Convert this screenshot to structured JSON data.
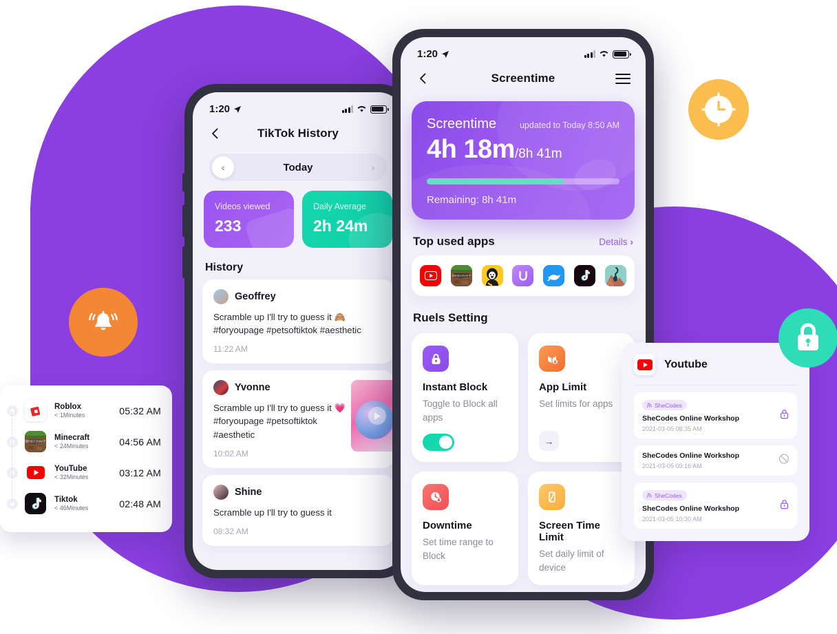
{
  "background": {
    "purple": "#8A3FE0",
    "accent_teal": "#14D9AE",
    "accent_orange": "#F58634",
    "accent_yellow": "#FBBD4E"
  },
  "fabs": [
    {
      "name": "notification-bell-badge",
      "icon": "bell-icon",
      "color": "#F58634"
    },
    {
      "name": "clock-badge",
      "icon": "clock-icon",
      "color": "#FBBD4E"
    },
    {
      "name": "lock-badge",
      "icon": "lock-icon",
      "color": "#2FDCB8"
    }
  ],
  "screentime_phone": {
    "statusbar": {
      "time": "1:20",
      "location_icon": "location-arrow-icon",
      "signal_icon": "cellular-signal-icon",
      "wifi_icon": "wifi-icon",
      "battery_icon": "battery-icon"
    },
    "navbar": {
      "back_icon": "chevron-left-icon",
      "title": "Screentime",
      "menu_icon": "hamburger-menu-icon"
    },
    "card": {
      "label": "Screentime",
      "updated": "updated to Today 8:50 AM",
      "used": "4h 18m",
      "total": "/8h 41m",
      "progress_percent": 71,
      "remaining": "Remaining: 8h 41m"
    },
    "top_apps": {
      "title": "Top used apps",
      "details_label": "Details",
      "details_chevron": "›",
      "apps": [
        {
          "name": "youtube",
          "label": "YouTube"
        },
        {
          "name": "minecraft",
          "label": "Minecraft"
        },
        {
          "name": "gorilla-game",
          "label": "Gorilla Tag"
        },
        {
          "name": "u-app",
          "label": "U"
        },
        {
          "name": "bird-app",
          "label": "Bird"
        },
        {
          "name": "tiktok",
          "label": "TikTok"
        },
        {
          "name": "adventure-game",
          "label": "Adventure"
        }
      ]
    },
    "rules": {
      "title": "Ruels Setting",
      "items": [
        {
          "name": "instant-block",
          "icon": "lock-icon",
          "icon_color": "#8B4BE8",
          "title": "Instant Block",
          "desc": "Toggle to Block all apps",
          "control": "toggle",
          "toggle_on": true
        },
        {
          "name": "app-limit",
          "icon": "app-limit-icon",
          "icon_color": "#F5803E",
          "title": "App Limit",
          "desc": "Set limits for apps",
          "control": "arrow",
          "arrow": "→"
        },
        {
          "name": "downtime",
          "icon": "clock-lock-icon",
          "icon_color": "#F4615F",
          "title": "Downtime",
          "desc": "Set time range to Block",
          "control": "none"
        },
        {
          "name": "screen-time-limit",
          "icon": "phone-icon",
          "icon_color": "#FBBD4E",
          "title": "Screen Time Limit",
          "desc": "Set daily limit of device",
          "control": "none"
        }
      ]
    }
  },
  "tiktok_phone": {
    "statusbar": {
      "time": "1:20"
    },
    "navbar": {
      "back_icon": "chevron-left-icon",
      "title": "TikTok History"
    },
    "day_switch": {
      "prev": "‹",
      "label": "Today",
      "next": "›"
    },
    "stats": [
      {
        "name": "videos-viewed",
        "caption": "Videos viewed",
        "value": "233",
        "color": "#9B55F0"
      },
      {
        "name": "daily-average",
        "caption": "Daily Average",
        "value": "2h 24m",
        "color": "#16D6AE"
      }
    ],
    "history_title": "History",
    "history": [
      {
        "user": "Geoffrey",
        "text": "Scramble up I'll try to guess it 🙈#foryoupage #petsoftiktok #aesthetic",
        "time": "11:22 AM",
        "has_thumb": false
      },
      {
        "user": "Yvonne",
        "text": "Scramble up I'll try to guess it 💗 #foryoupage #petsoftiktok #aesthetic",
        "time": "10:02 AM",
        "has_thumb": true
      },
      {
        "user": "Shine",
        "text": "Scramble up I'll try to guess it",
        "time": "08:32 AM",
        "has_thumb": false
      }
    ]
  },
  "app_list_card": {
    "rows": [
      {
        "name": "Roblox",
        "sub": "< 1Minutes",
        "time": "05:32 AM",
        "icon": "roblox-icon"
      },
      {
        "name": "Minecraft",
        "sub": "< 24Minutes",
        "time": "04:56 AM",
        "icon": "minecraft-icon"
      },
      {
        "name": "YouTube",
        "sub": "< 32Minutes",
        "time": "03:12 AM",
        "icon": "youtube-icon"
      },
      {
        "name": "Tiktok",
        "sub": "< 46Minutes",
        "time": "02:48 AM",
        "icon": "tiktok-icon"
      }
    ]
  },
  "youtube_card": {
    "title": "Youtube",
    "icon": "youtube-icon",
    "items": [
      {
        "tag": "SheCodes",
        "has_tag": true,
        "name": "SheCodes Online Workshop",
        "date": "2021-03-05 08:35 AM",
        "status": "lock-icon"
      },
      {
        "tag": "",
        "has_tag": false,
        "name": "SheCodes Online Workshop",
        "date": "2021-03-05 09:16 AM",
        "status": "blocked-icon"
      },
      {
        "tag": "SheCodes",
        "has_tag": true,
        "name": "SheCodes Online Workshop",
        "date": "2021-03-05 10:30 AM",
        "status": "lock-icon"
      }
    ]
  }
}
